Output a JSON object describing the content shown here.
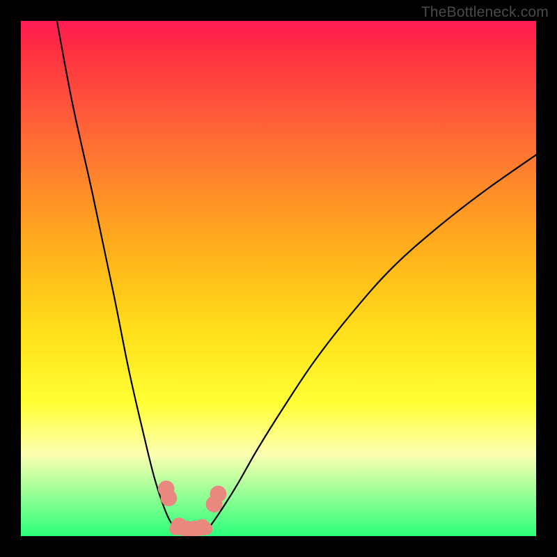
{
  "watermark": "TheBottleneck.com",
  "chart_data": {
    "type": "line",
    "title": "",
    "xlabel": "",
    "ylabel": "",
    "xlim": [
      0,
      100
    ],
    "ylim": [
      0,
      100
    ],
    "grid": false,
    "legend": false,
    "series": [
      {
        "name": "left-branch",
        "x": [
          7,
          10,
          14,
          18,
          21,
          24,
          26,
          28,
          29.5,
          30.5,
          31.5
        ],
        "y": [
          100,
          84,
          66,
          47,
          32,
          19,
          11,
          5,
          2,
          1,
          0.5
        ]
      },
      {
        "name": "right-branch",
        "x": [
          35,
          36,
          37.5,
          39.5,
          42,
          46,
          51,
          57,
          64,
          72,
          81,
          90,
          100
        ],
        "y": [
          0.5,
          1,
          3,
          6,
          10,
          17,
          25,
          34,
          43,
          52,
          60,
          67,
          74
        ]
      },
      {
        "name": "valley-floor",
        "x": [
          31.5,
          32.5,
          33.5,
          34.5,
          35
        ],
        "y": [
          0.5,
          0.2,
          0.2,
          0.3,
          0.5
        ]
      }
    ],
    "markers": [
      {
        "name": "left-upper-dot",
        "x": 28.2,
        "y": 9.2,
        "r": 1.6,
        "color": "#e8887e"
      },
      {
        "name": "left-lower-dot",
        "x": 28.7,
        "y": 7.4,
        "r": 1.6,
        "color": "#e8887e"
      },
      {
        "name": "right-upper-dot",
        "x": 38.3,
        "y": 8.2,
        "r": 1.6,
        "color": "#e8887e"
      },
      {
        "name": "right-lower-dot",
        "x": 37.5,
        "y": 6.2,
        "r": 1.6,
        "color": "#e8887e"
      },
      {
        "name": "trough-dot-1",
        "x": 30.7,
        "y": 2.0,
        "r": 1.6,
        "color": "#e8887e"
      },
      {
        "name": "trough-dot-2",
        "x": 32.2,
        "y": 1.4,
        "r": 1.6,
        "color": "#e8887e"
      },
      {
        "name": "trough-dot-3",
        "x": 33.7,
        "y": 1.4,
        "r": 1.6,
        "color": "#e8887e"
      },
      {
        "name": "trough-dot-4",
        "x": 35.2,
        "y": 1.7,
        "r": 1.6,
        "color": "#e8887e"
      }
    ],
    "trough_bar": {
      "x0": 30.0,
      "x1": 36.0,
      "y": 1.4,
      "thickness": 2.4,
      "color": "#e8887e"
    }
  }
}
